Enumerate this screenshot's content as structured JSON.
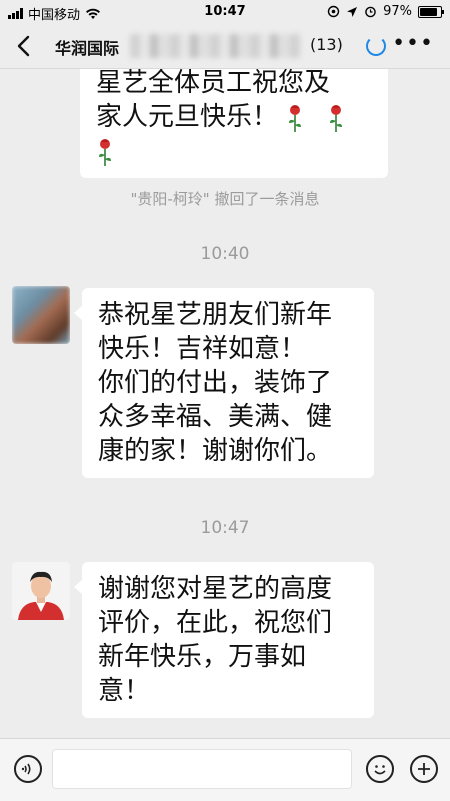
{
  "status_bar": {
    "carrier": "中国移动",
    "time": "10:47",
    "battery": "97%",
    "battery_level": 0.97
  },
  "nav": {
    "title": "华润国际",
    "member_count": "(13)"
  },
  "messages": {
    "partial_top_line1": "星艺全体员工祝您及",
    "partial_top_line2": "家人元旦快乐！",
    "recall_notice": "\"贵阳-柯玲\" 撤回了一条消息",
    "time_1": "10:40",
    "msg_2_lines": [
      "恭祝星艺朋友们新年",
      "快乐！吉祥如意！",
      "你们的付出，装饰了",
      "众多幸福、美满、健",
      "康的家！谢谢你们。"
    ],
    "time_2": "10:47",
    "msg_3_lines": [
      "谢谢您对星艺的高度",
      "评价，在此，祝您们",
      "新年快乐，万事如",
      "意！"
    ]
  },
  "icons": {
    "back": "chevron-left-icon",
    "more": "more-dots-icon",
    "voice": "voice-icon",
    "emoji": "emoji-icon",
    "plus": "plus-icon",
    "rose": "rose-icon"
  },
  "colors": {
    "background": "#ededed",
    "bubble": "#ffffff",
    "accent_ring": "#1e88e5"
  }
}
